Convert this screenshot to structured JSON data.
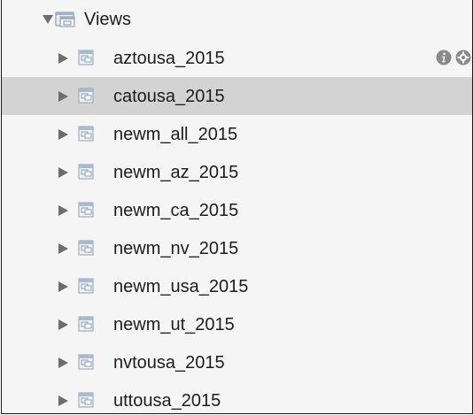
{
  "tree": {
    "group": {
      "label": "Views",
      "icon": "views-folder-icon",
      "expanded": true
    },
    "items": [
      {
        "label": "aztousa_2015",
        "icon": "view-icon",
        "selected": false,
        "hover_actions": [
          "info-icon",
          "gear-icon"
        ]
      },
      {
        "label": "catousa_2015",
        "icon": "view-icon",
        "selected": true
      },
      {
        "label": "newm_all_2015",
        "icon": "view-icon",
        "selected": false
      },
      {
        "label": "newm_az_2015",
        "icon": "view-icon",
        "selected": false
      },
      {
        "label": "newm_ca_2015",
        "icon": "view-icon",
        "selected": false
      },
      {
        "label": "newm_nv_2015",
        "icon": "view-icon",
        "selected": false
      },
      {
        "label": "newm_usa_2015",
        "icon": "view-icon",
        "selected": false
      },
      {
        "label": "newm_ut_2015",
        "icon": "view-icon",
        "selected": false
      },
      {
        "label": "nvtousa_2015",
        "icon": "view-icon",
        "selected": false
      },
      {
        "label": "uttousa_2015",
        "icon": "view-icon",
        "selected": false
      }
    ]
  },
  "colors": {
    "background": "#f5f5f5",
    "selected_row": "#d3d3d3",
    "text": "#1d1d1d",
    "disclosure": "#6d6d6d",
    "icon_fill": "#9fb2c4"
  }
}
